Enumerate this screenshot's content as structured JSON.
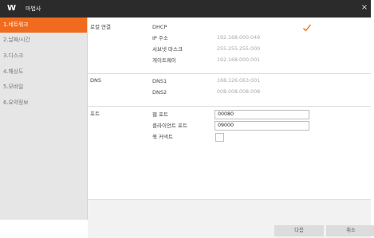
{
  "window": {
    "title": "마법사",
    "logo_text": "W",
    "close_glyph": "×"
  },
  "sidebar": {
    "items": [
      {
        "label": "1.네트워크",
        "active": true
      },
      {
        "label": "2.날짜/시간",
        "active": false
      },
      {
        "label": "3.디스크",
        "active": false
      },
      {
        "label": "4.해상도",
        "active": false
      },
      {
        "label": "5.모바일",
        "active": false
      },
      {
        "label": "6.요약정보",
        "active": false
      }
    ]
  },
  "local_network": {
    "section_label": "로컬 연결",
    "dhcp_label": "DHCP",
    "dhcp_checked": true,
    "ip_label": "IP 주소",
    "ip_value": "192.168.000.049",
    "subnet_label": "서브넷 마스크",
    "subnet_value": "255.255.255.000",
    "gateway_label": "게이트웨이",
    "gateway_value": "192.168.000.001"
  },
  "dns": {
    "section_label": "DNS",
    "dns1_label": "DNS1",
    "dns1_value": "168.126.063.001",
    "dns2_label": "DNS2",
    "dns2_value": "008.008.008.008"
  },
  "ports": {
    "section_label": "포트",
    "web_port_label": "웹 포트",
    "web_port_value": "00080",
    "client_port_label": "클라이언트 포트",
    "client_port_value": "09000",
    "quick_connect_label": "퀵 커넥트",
    "quick_connect_checked": false
  },
  "footer": {
    "next_label": "다음",
    "cancel_label": "취소"
  },
  "colors": {
    "accent": "#f06b1d",
    "titlebar": "#2b2b2b",
    "sidebar_bg": "#e6e6e6"
  }
}
